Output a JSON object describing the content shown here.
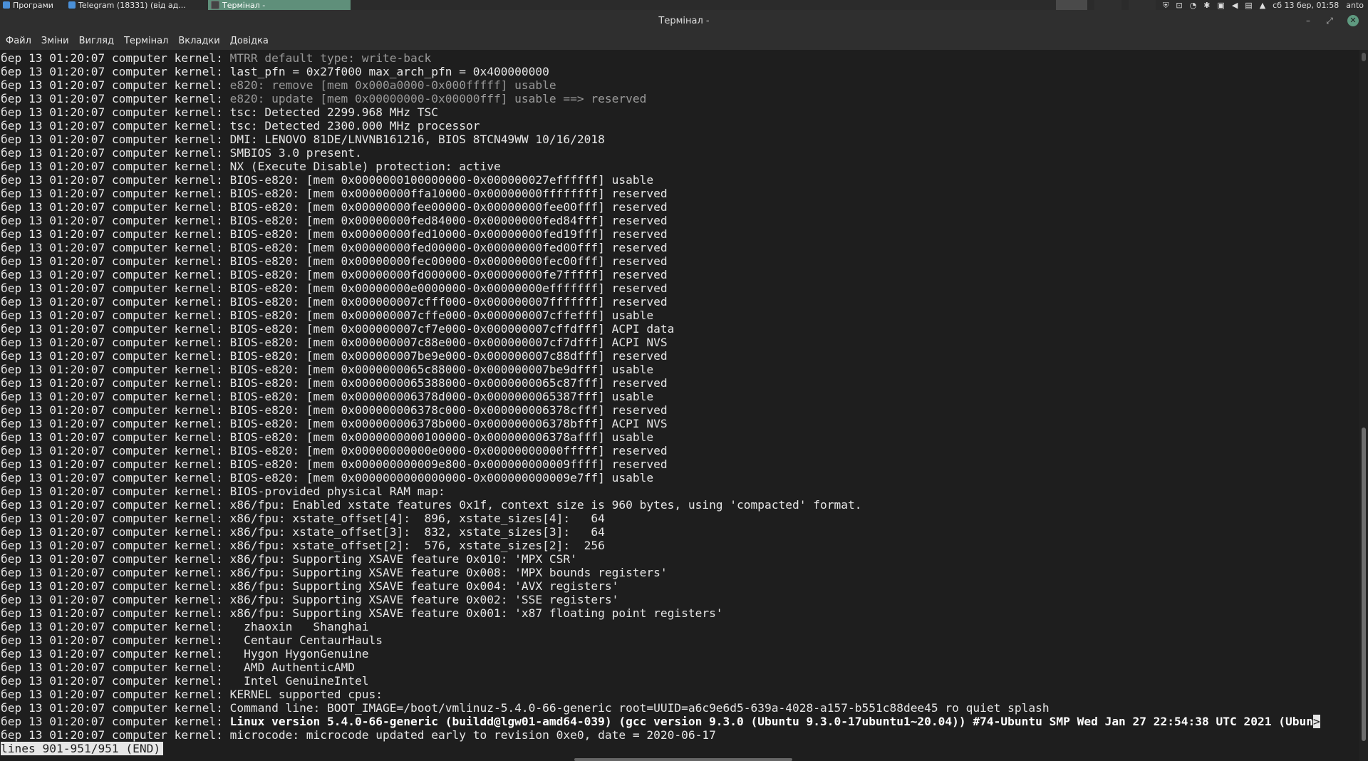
{
  "panel": {
    "apps_label": "Програми",
    "telegram_label": "Telegram (18331) (від ад...",
    "terminal_task_label": "Термінал -",
    "datetime": "сб 13 бер, 01:58",
    "user": "anto"
  },
  "window": {
    "title": "Термінал -",
    "minimize": "–",
    "maximize": "⤢",
    "close": "✕"
  },
  "menu": [
    "Файл",
    "Зміни",
    "Вигляд",
    "Термінал",
    "Вкладки",
    "Довідка"
  ],
  "terminal": {
    "prefix": "бер 13 01:20:07 computer kernel: ",
    "lines": [
      {
        "t": "MTRR default type: write-back",
        "s": "dim"
      },
      {
        "t": "last_pfn = 0x27f000 max_arch_pfn = 0x400000000",
        "s": ""
      },
      {
        "t": "e820: remove [mem 0x000a0000-0x000fffff] usable",
        "s": "dim"
      },
      {
        "t": "e820: update [mem 0x00000000-0x00000fff] usable ==> reserved",
        "s": "dim"
      },
      {
        "t": "tsc: Detected 2299.968 MHz TSC",
        "s": ""
      },
      {
        "t": "tsc: Detected 2300.000 MHz processor",
        "s": ""
      },
      {
        "t": "DMI: LENOVO 81DE/LNVNB161216, BIOS 8TCN49WW 10/16/2018",
        "s": ""
      },
      {
        "t": "SMBIOS 3.0 present.",
        "s": ""
      },
      {
        "t": "NX (Execute Disable) protection: active",
        "s": ""
      },
      {
        "t": "BIOS-e820: [mem 0x0000000100000000-0x000000027effffff] usable",
        "s": ""
      },
      {
        "t": "BIOS-e820: [mem 0x00000000ffa10000-0x00000000ffffffff] reserved",
        "s": ""
      },
      {
        "t": "BIOS-e820: [mem 0x00000000fee00000-0x00000000fee00fff] reserved",
        "s": ""
      },
      {
        "t": "BIOS-e820: [mem 0x00000000fed84000-0x00000000fed84fff] reserved",
        "s": ""
      },
      {
        "t": "BIOS-e820: [mem 0x00000000fed10000-0x00000000fed19fff] reserved",
        "s": ""
      },
      {
        "t": "BIOS-e820: [mem 0x00000000fed00000-0x00000000fed00fff] reserved",
        "s": ""
      },
      {
        "t": "BIOS-e820: [mem 0x00000000fec00000-0x00000000fec00fff] reserved",
        "s": ""
      },
      {
        "t": "BIOS-e820: [mem 0x00000000fd000000-0x00000000fe7fffff] reserved",
        "s": ""
      },
      {
        "t": "BIOS-e820: [mem 0x00000000e0000000-0x00000000efffffff] reserved",
        "s": ""
      },
      {
        "t": "BIOS-e820: [mem 0x000000007cfff000-0x000000007fffffff] reserved",
        "s": ""
      },
      {
        "t": "BIOS-e820: [mem 0x000000007cffe000-0x000000007cffefff] usable",
        "s": ""
      },
      {
        "t": "BIOS-e820: [mem 0x000000007cf7e000-0x000000007cffdfff] ACPI data",
        "s": ""
      },
      {
        "t": "BIOS-e820: [mem 0x000000007c88e000-0x000000007cf7dfff] ACPI NVS",
        "s": ""
      },
      {
        "t": "BIOS-e820: [mem 0x000000007be9e000-0x000000007c88dfff] reserved",
        "s": ""
      },
      {
        "t": "BIOS-e820: [mem 0x0000000065c88000-0x000000007be9dfff] usable",
        "s": ""
      },
      {
        "t": "BIOS-e820: [mem 0x0000000065388000-0x0000000065c87fff] reserved",
        "s": ""
      },
      {
        "t": "BIOS-e820: [mem 0x000000006378d000-0x0000000065387fff] usable",
        "s": ""
      },
      {
        "t": "BIOS-e820: [mem 0x000000006378c000-0x000000006378cfff] reserved",
        "s": ""
      },
      {
        "t": "BIOS-e820: [mem 0x000000006378b000-0x000000006378bfff] ACPI NVS",
        "s": ""
      },
      {
        "t": "BIOS-e820: [mem 0x0000000000100000-0x000000006378afff] usable",
        "s": ""
      },
      {
        "t": "BIOS-e820: [mem 0x00000000000e0000-0x00000000000fffff] reserved",
        "s": ""
      },
      {
        "t": "BIOS-e820: [mem 0x000000000009e800-0x000000000009ffff] reserved",
        "s": ""
      },
      {
        "t": "BIOS-e820: [mem 0x0000000000000000-0x000000000009e7ff] usable",
        "s": ""
      },
      {
        "t": "BIOS-provided physical RAM map:",
        "s": ""
      },
      {
        "t": "x86/fpu: Enabled xstate features 0x1f, context size is 960 bytes, using 'compacted' format.",
        "s": ""
      },
      {
        "t": "x86/fpu: xstate_offset[4]:  896, xstate_sizes[4]:   64",
        "s": ""
      },
      {
        "t": "x86/fpu: xstate_offset[3]:  832, xstate_sizes[3]:   64",
        "s": ""
      },
      {
        "t": "x86/fpu: xstate_offset[2]:  576, xstate_sizes[2]:  256",
        "s": ""
      },
      {
        "t": "x86/fpu: Supporting XSAVE feature 0x010: 'MPX CSR'",
        "s": ""
      },
      {
        "t": "x86/fpu: Supporting XSAVE feature 0x008: 'MPX bounds registers'",
        "s": ""
      },
      {
        "t": "x86/fpu: Supporting XSAVE feature 0x004: 'AVX registers'",
        "s": ""
      },
      {
        "t": "x86/fpu: Supporting XSAVE feature 0x002: 'SSE registers'",
        "s": ""
      },
      {
        "t": "x86/fpu: Supporting XSAVE feature 0x001: 'x87 floating point registers'",
        "s": ""
      },
      {
        "t": "  zhaoxin   Shanghai",
        "s": ""
      },
      {
        "t": "  Centaur CentaurHauls",
        "s": ""
      },
      {
        "t": "  Hygon HygonGenuine",
        "s": ""
      },
      {
        "t": "  AMD AuthenticAMD",
        "s": ""
      },
      {
        "t": "  Intel GenuineIntel",
        "s": ""
      },
      {
        "t": "KERNEL supported cpus:",
        "s": ""
      },
      {
        "t": "Command line: BOOT_IMAGE=/boot/vmlinuz-5.4.0-66-generic root=UUID=a6c9e6d5-639a-4028-a157-b551c88dee45 ro quiet splash",
        "s": ""
      },
      {
        "t": "Linux version 5.4.0-66-generic (buildd@lgw01-amd64-039) (gcc version 9.3.0 (Ubuntu 9.3.0-17ubuntu1~20.04)) #74-Ubuntu SMP Wed Jan 27 22:54:38 UTC 2021 (Ubun",
        "s": "bold",
        "trail": ">"
      },
      {
        "t": "microcode: microcode updated early to revision 0xe0, date = 2020-06-17",
        "s": ""
      }
    ],
    "status": "lines 901-951/951 (END)"
  }
}
